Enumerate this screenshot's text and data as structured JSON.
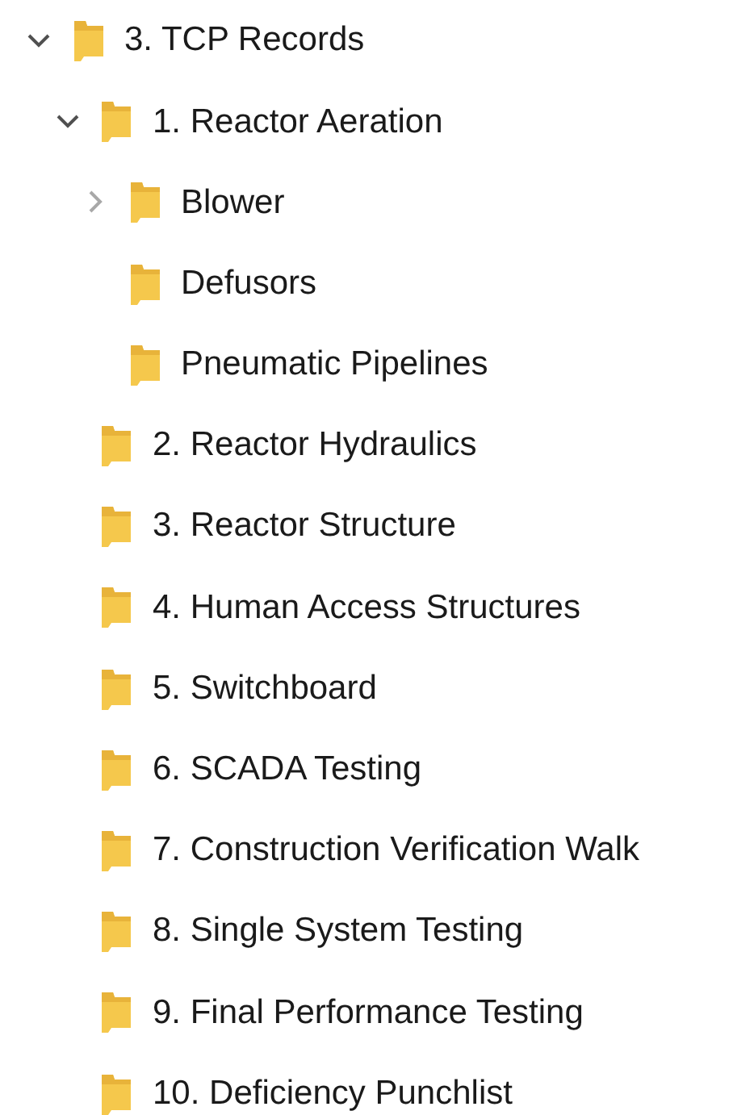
{
  "tree": [
    {
      "label": "3. TCP Records",
      "expanded": true,
      "children": [
        {
          "label": "1. Reactor Aeration",
          "expanded": true,
          "children": [
            {
              "label": "Blower",
              "expanded": false
            },
            {
              "label": "Defusors"
            },
            {
              "label": "Pneumatic Pipelines"
            }
          ]
        },
        {
          "label": "2. Reactor Hydraulics"
        },
        {
          "label": "3. Reactor Structure"
        },
        {
          "label": "4. Human Access Structures"
        },
        {
          "label": "5. Switchboard"
        },
        {
          "label": "6. SCADA Testing"
        },
        {
          "label": "7. Construction Verification Walk"
        },
        {
          "label": "8. Single System Testing"
        },
        {
          "label": "9. Final Performance Testing"
        },
        {
          "label": "10. Deficiency Punchlist"
        }
      ]
    }
  ]
}
